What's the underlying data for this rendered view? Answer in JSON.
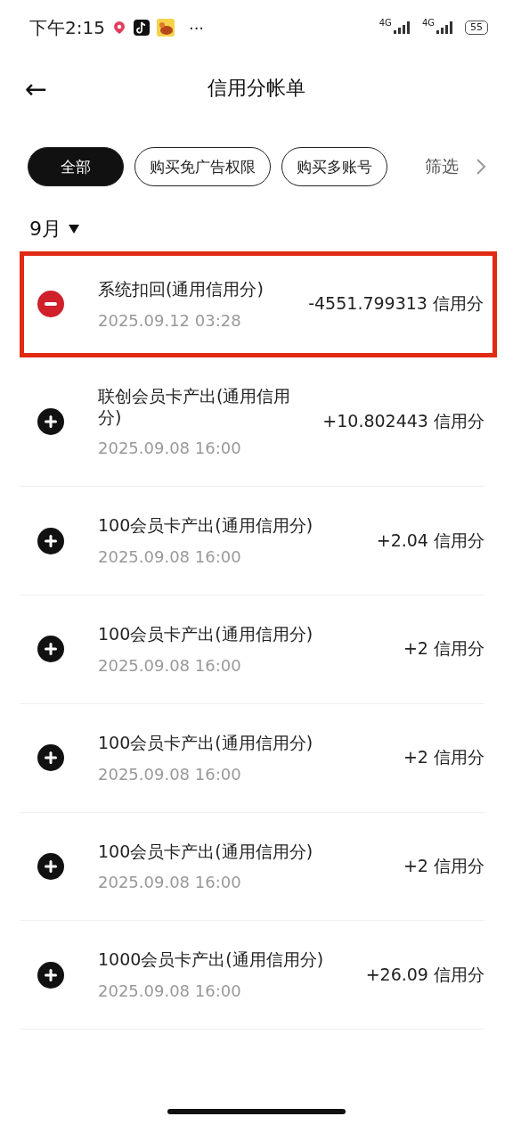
{
  "status_bar": {
    "time": "下午2:15",
    "more": "···",
    "networks": [
      "4G",
      "4G"
    ],
    "battery": "55"
  },
  "header": {
    "back": "←",
    "title": "信用分帐单"
  },
  "filters": [
    {
      "label": "全部",
      "selected": true
    },
    {
      "label": "购买免广告权限",
      "selected": false
    },
    {
      "label": "购买多账号",
      "selected": false
    }
  ],
  "filter_button": "筛选",
  "month": "9月",
  "transactions": [
    {
      "kind": "debit",
      "title": "系统扣回(通用信用分)",
      "time": "2025.09.12 03:28",
      "amount": "-4551.799313 信用分",
      "highlighted": true
    },
    {
      "kind": "credit",
      "title": "联创会员卡产出(通用信用分)",
      "time": "2025.09.08 16:00",
      "amount": "+10.802443 信用分",
      "highlighted": false
    },
    {
      "kind": "credit",
      "title": "100会员卡产出(通用信用分)",
      "time": "2025.09.08 16:00",
      "amount": "+2.04 信用分",
      "highlighted": false
    },
    {
      "kind": "credit",
      "title": "100会员卡产出(通用信用分)",
      "time": "2025.09.08 16:00",
      "amount": "+2 信用分",
      "highlighted": false
    },
    {
      "kind": "credit",
      "title": "100会员卡产出(通用信用分)",
      "time": "2025.09.08 16:00",
      "amount": "+2 信用分",
      "highlighted": false
    },
    {
      "kind": "credit",
      "title": "100会员卡产出(通用信用分)",
      "time": "2025.09.08 16:00",
      "amount": "+2 信用分",
      "highlighted": false
    },
    {
      "kind": "credit",
      "title": "1000会员卡产出(通用信用分)",
      "time": "2025.09.08 16:00",
      "amount": "+26.09 信用分",
      "highlighted": false
    }
  ]
}
